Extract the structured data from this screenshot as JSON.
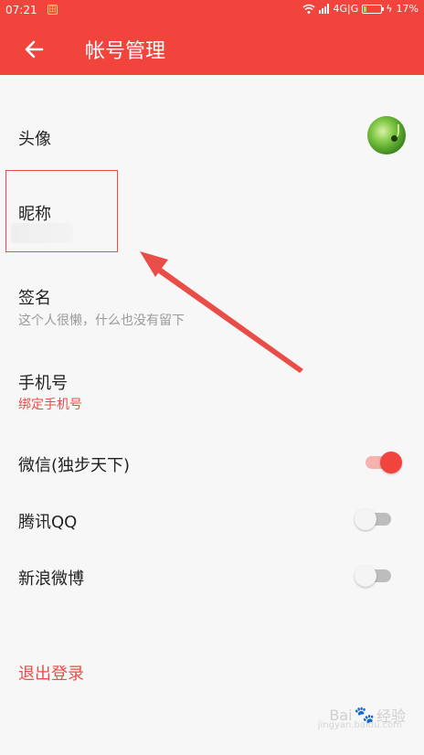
{
  "status_bar": {
    "time": "07:21",
    "network": "4G|G",
    "battery_percent": "17%",
    "battery_fill": 0.17
  },
  "app_bar": {
    "title": "帐号管理"
  },
  "rows": {
    "avatar": {
      "label": "头像"
    },
    "nickname": {
      "label": "昵称"
    },
    "signature": {
      "label": "签名",
      "value": "这个人很懒，什么也没有留下"
    },
    "phone": {
      "label": "手机号",
      "value": "绑定手机号"
    },
    "wechat": {
      "label": "微信(独步天下)",
      "enabled": true
    },
    "qq": {
      "label": "腾讯QQ",
      "enabled": false
    },
    "weibo": {
      "label": "新浪微博",
      "enabled": false
    }
  },
  "logout_label": "退出登录",
  "watermark": {
    "brand": "Bai",
    "brand_suffix": "经验",
    "site": "jingyan.baidu.com"
  },
  "colors": {
    "accent": "#f0443d",
    "link_red": "#e94d47",
    "annotation_red": "#e94d47"
  }
}
